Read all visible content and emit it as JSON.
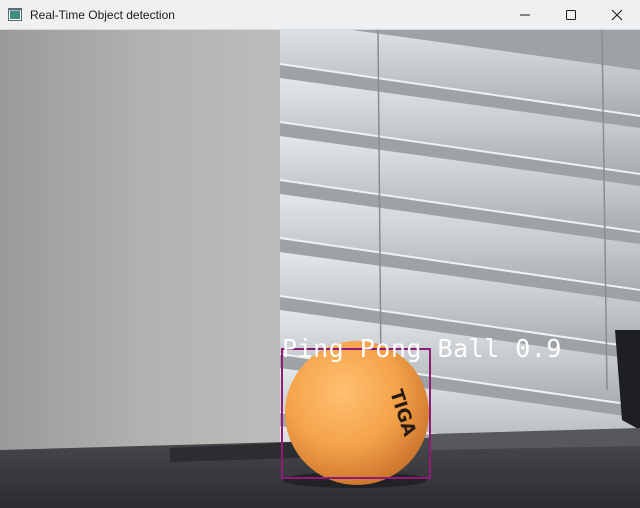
{
  "window": {
    "title": "Real-Time Object detection",
    "icons": {
      "app": "app-window-icon",
      "minimize": "minimize-icon",
      "maximize": "maximize-icon",
      "close": "close-icon"
    }
  },
  "detection": {
    "label": "Ping Pong Ball",
    "confidence": "0.9",
    "label_text": "Ping Pong Ball 0.9",
    "box_color": "#8e1b78",
    "text_color": "#ffffff"
  },
  "colors": {
    "wall": "#a9aaa8",
    "blinds": "#c4c8ca",
    "ball": "#f2a24a",
    "desk": "#3a3b3e"
  }
}
